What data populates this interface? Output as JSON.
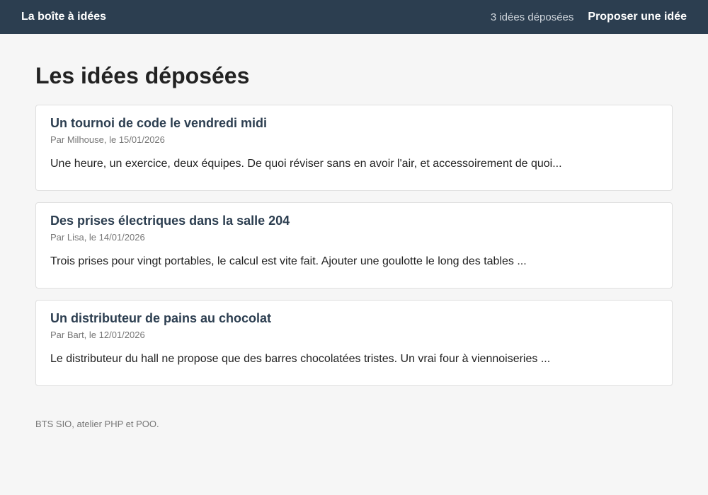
{
  "header": {
    "brand": "La boîte à idées",
    "count": "3 idées déposées",
    "propose_link": "Proposer une idée"
  },
  "main": {
    "title": "Les idées déposées",
    "ideas": [
      {
        "title": "Un tournoi de code le vendredi midi",
        "meta": "Par Milhouse, le 15/01/2026",
        "excerpt": "Une heure, un exercice, deux équipes. De quoi réviser sans en avoir l'air, et accessoirement de quoi..."
      },
      {
        "title": "Des prises électriques dans la salle 204",
        "meta": "Par Lisa, le 14/01/2026",
        "excerpt": "Trois prises pour vingt portables, le calcul est vite fait. Ajouter une goulotte le long des tables ..."
      },
      {
        "title": "Un distributeur de pains au chocolat",
        "meta": "Par Bart, le 12/01/2026",
        "excerpt": "Le distributeur du hall ne propose que des barres chocolatées tristes. Un vrai four à viennoiseries ..."
      }
    ]
  },
  "footer": {
    "text": "BTS SIO, atelier PHP et POO."
  },
  "colors": {
    "header_bg": "#2c3e50",
    "page_bg": "#f6f6f6",
    "card_title": "#2c3e50"
  }
}
